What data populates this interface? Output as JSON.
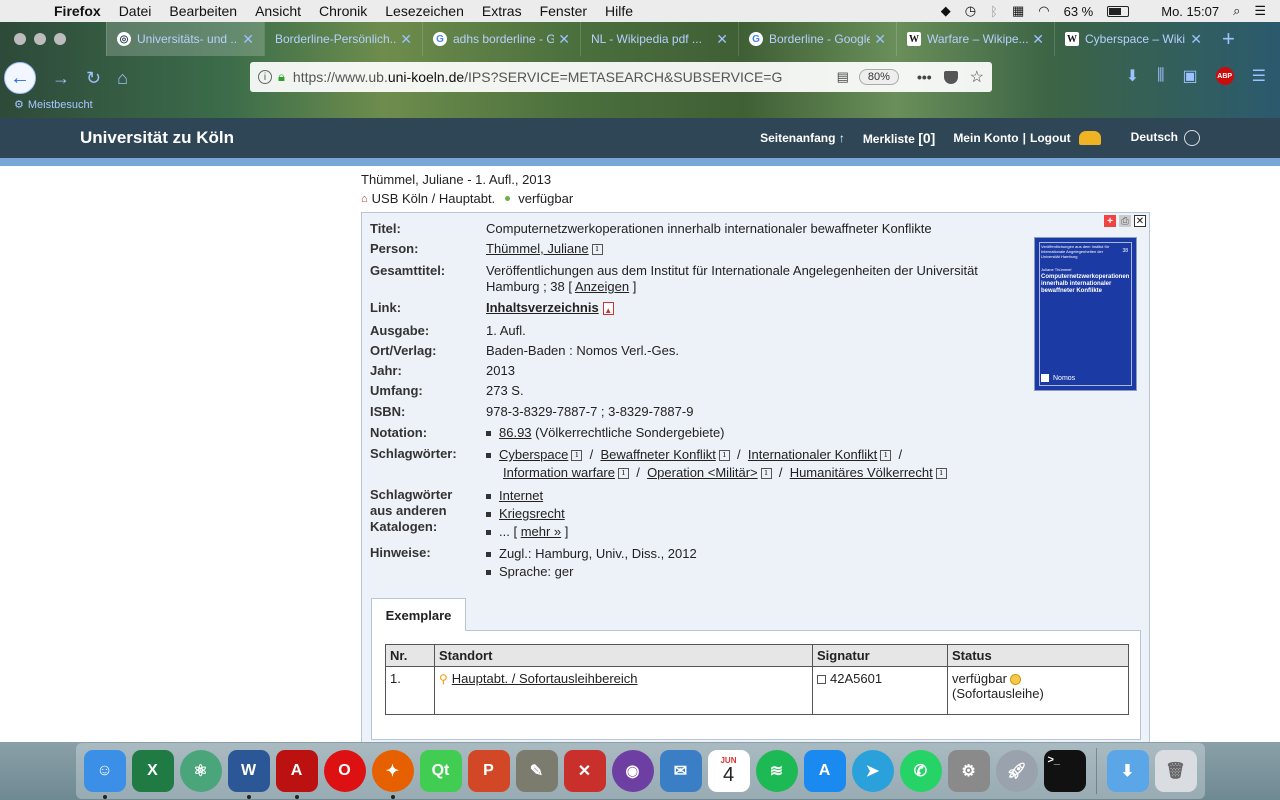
{
  "menubar": {
    "app": "Firefox",
    "items": [
      "Datei",
      "Bearbeiten",
      "Ansicht",
      "Chronik",
      "Lesezeichen",
      "Extras",
      "Fenster",
      "Hilfe"
    ],
    "battery": "63 %",
    "clock": "Mo. 15:07"
  },
  "tabs": [
    {
      "title": "Universitäts- und ...",
      "icon": "ub-icon",
      "active": true
    },
    {
      "title": "Borderline-Persönlich...",
      "icon": "",
      "active": false
    },
    {
      "title": "adhs borderline - Go...",
      "icon": "google-icon",
      "active": false
    },
    {
      "title": "NL - Wikipedia pdf ...",
      "icon": "",
      "active": false
    },
    {
      "title": "Borderline - Google ...",
      "icon": "google-icon",
      "active": false
    },
    {
      "title": "Warfare – Wikipe...",
      "icon": "wikipedia-icon",
      "active": false
    },
    {
      "title": "Cyberspace – Wiki...",
      "icon": "wikipedia-icon",
      "active": false
    }
  ],
  "urlbar": {
    "prefix": "https://www.ub.",
    "domain": "uni-koeln.de",
    "path": "/IPS?SERVICE=METASEARCH&SUBSERVICE=G",
    "zoom": "80%"
  },
  "bookmarks": {
    "label": "Meistbesucht"
  },
  "site": {
    "brand": "Universität zu Köln",
    "nav_top": "Seitenanfang",
    "nav_merkliste": "Merkliste",
    "merkliste_count": "[0]",
    "nav_konto": "Mein Konto",
    "nav_logout": "Logout",
    "nav_lang": "Deutsch"
  },
  "record_header": {
    "author_line": "Thümmel, Juliane - 1. Aufl., 2013",
    "location": "USB Köln / Hauptabt.",
    "availability": "verfügbar"
  },
  "detail": {
    "titel_label": "Titel:",
    "titel": "Computernetzwerkoperationen innerhalb internationaler bewaffneter Konflikte",
    "person_label": "Person:",
    "person": "Thümmel, Juliane",
    "gesamttitel_label": "Gesamttitel:",
    "gesamttitel": "Veröffentlichungen aus dem Institut für Internationale Angelegenheiten der Universität Hamburg ; 38 [",
    "gesamttitel_link": "Anzeigen",
    "link_label": "Link:",
    "link": "Inhaltsverzeichnis",
    "ausgabe_label": "Ausgabe:",
    "ausgabe": "1. Aufl.",
    "ort_label": "Ort/Verlag:",
    "ort": "Baden-Baden : Nomos Verl.-Ges.",
    "jahr_label": "Jahr:",
    "jahr": "2013",
    "umfang_label": "Umfang:",
    "umfang": "273 S.",
    "isbn_label": "ISBN:",
    "isbn": "978-3-8329-7887-7 ; 3-8329-7887-9",
    "notation_label": "Notation:",
    "notation_code": "86.93",
    "notation_desc": "(Völkerrechtliche Sondergebiete)",
    "schlag_label": "Schlagwörter:",
    "schlagwoerter": [
      "Cyberspace",
      "Bewaffneter Konflikt",
      "Internationaler Konflikt",
      "Information warfare",
      "Operation <Militär>",
      "Humanitäres Völkerrecht"
    ],
    "schlag_andere_label_1": "Schlagwörter",
    "schlag_andere_label_2": "aus anderen",
    "schlag_andere_label_3": "Katalogen:",
    "schlag_andere": [
      "Internet",
      "Kriegsrecht"
    ],
    "mehr_prefix": "... [",
    "mehr_link": "mehr »",
    "mehr_suffix": "]",
    "hinweise_label": "Hinweise:",
    "hinweise": [
      "Zugl.: Hamburg, Univ., Diss., 2012",
      "Sprache: ger"
    ]
  },
  "cover": {
    "series": "Veröffentlichungen aus dem Institut für Internationale Angelegenheiten der Universität Hamburg",
    "number": "38",
    "author": "Juliane Thümmel",
    "title": "Computernetzwerkoperationen innerhalb internationaler bewaffneter Konflikte",
    "publisher": "Nomos"
  },
  "exemplare": {
    "tab_label": "Exemplare",
    "headers": [
      "Nr.",
      "Standort",
      "Signatur",
      "Status"
    ],
    "rows": [
      {
        "nr": "1.",
        "standort": "Hauptabt. / Sofortausleihbereich",
        "signatur": "42A5601",
        "status": "verfügbar",
        "status_note": "(Sofortausleihe)"
      }
    ]
  },
  "dock": [
    "Finder",
    "Excel",
    "Atom",
    "Word",
    "Acrobat",
    "Opera",
    "Firefox",
    "Qt",
    "PowerPoint",
    "GIMP",
    "Xmind",
    "GitHub",
    "Mail",
    "Kalender",
    "Spotify",
    "App Store",
    "Telegram",
    "WhatsApp",
    "Systemeinstellungen",
    "Launchpad",
    "Terminal",
    "Downloads",
    "Papierkorb"
  ],
  "dock_calendar": {
    "month": "JUN",
    "day": "4"
  },
  "colors": {
    "header": "#2f4656",
    "band": "#7aa7d8",
    "box": "#edf2f8"
  }
}
